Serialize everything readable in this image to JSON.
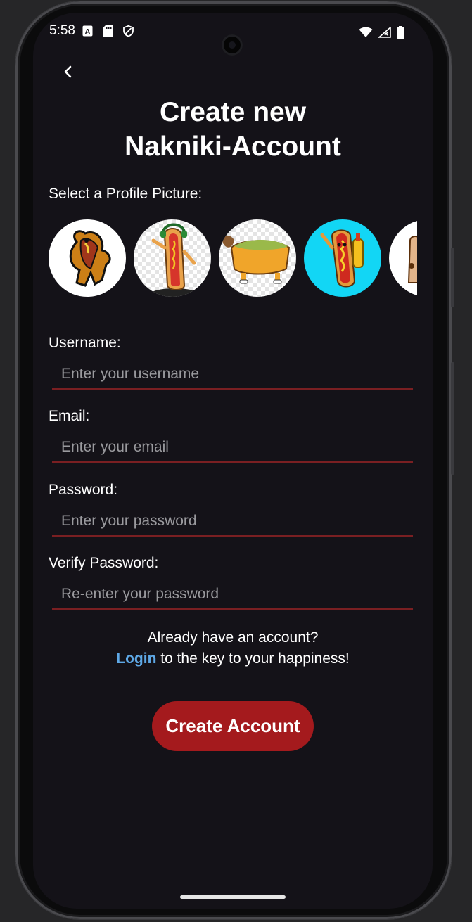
{
  "status_bar": {
    "time": "5:58",
    "left_icons": [
      "text-a-icon",
      "sd-card-icon",
      "shield-icon"
    ],
    "right_icons": [
      "wifi-icon",
      "signal-icon",
      "battery-icon"
    ]
  },
  "header": {
    "back_icon": "chevron-left-icon",
    "title_line1": "Create new",
    "title_line2": "Nakniki-Account"
  },
  "profile_picture": {
    "label": "Select a Profile Picture:",
    "options": [
      {
        "name": "hotdog-dancing-sticker",
        "background": "#ffffff"
      },
      {
        "name": "hotdog-headphones",
        "background": "checker"
      },
      {
        "name": "hotdog-dog-guacamole",
        "background": "checker"
      },
      {
        "name": "hotdog-mustard-cyan",
        "background": "#12d6f5"
      },
      {
        "name": "hotdog-partial",
        "background": "#ffffff"
      }
    ]
  },
  "form": {
    "username": {
      "label": "Username:",
      "placeholder": "Enter your username",
      "value": ""
    },
    "email": {
      "label": "Email:",
      "placeholder": "Enter your email",
      "value": ""
    },
    "password": {
      "label": "Password:",
      "placeholder": "Enter your password",
      "value": ""
    },
    "verify_password": {
      "label": "Verify Password:",
      "placeholder": "Re-enter your password",
      "value": ""
    }
  },
  "login_prompt": {
    "line1": "Already have an account?",
    "link": "Login",
    "line2_rest": " to the key to your happiness!"
  },
  "submit": {
    "label": "Create Account"
  },
  "colors": {
    "background": "#141218",
    "accent_red": "#a41a1d",
    "underline": "#7a1f22",
    "link_blue": "#5ea8e6"
  }
}
